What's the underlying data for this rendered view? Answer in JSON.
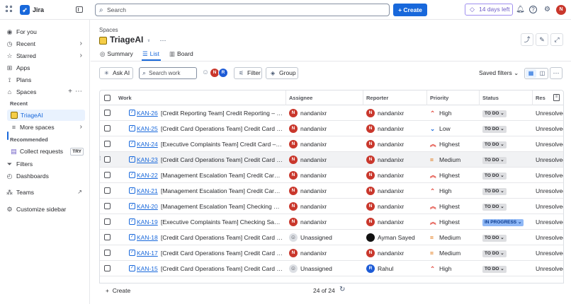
{
  "app": {
    "name": "Jira",
    "brand_color": "#1868db"
  },
  "topbar": {
    "search_placeholder": "Search",
    "create_label": "Create",
    "trial_label": "14 days left",
    "user_initial": "N"
  },
  "sidebar": {
    "items": [
      {
        "label": "For you",
        "icon": "user-circle-icon"
      },
      {
        "label": "Recent",
        "icon": "clock-icon"
      },
      {
        "label": "Starred",
        "icon": "star-icon"
      },
      {
        "label": "Apps",
        "icon": "apps-icon"
      },
      {
        "label": "Plans",
        "icon": "plans-icon"
      },
      {
        "label": "Spaces",
        "icon": "spaces-icon"
      }
    ],
    "recent_heading": "Recent",
    "active_space": "TriageAI",
    "more_spaces": "More spaces",
    "recommended_heading": "Recommended",
    "collect_requests": "Collect requests",
    "try_badge": "TRY",
    "filters": "Filters",
    "dashboards": "Dashboards",
    "teams": "Teams",
    "customize": "Customize sidebar"
  },
  "header": {
    "breadcrumb": "Spaces",
    "title": "TriageAI"
  },
  "tabs": [
    {
      "label": "Summary",
      "icon": "globe-icon"
    },
    {
      "label": "List",
      "icon": "list-icon"
    },
    {
      "label": "Board",
      "icon": "board-icon"
    }
  ],
  "toolbar": {
    "ask_ai": "Ask AI",
    "search_placeholder": "Search work",
    "filter": "Filter",
    "group": "Group",
    "saved_filters": "Saved filters",
    "avatars": [
      "N",
      "R"
    ]
  },
  "table": {
    "headers": [
      "Work",
      "Assignee",
      "Reporter",
      "Priority",
      "Status",
      "Res"
    ],
    "rows": [
      {
        "key": "KAN-26",
        "summary": "[Credit Reporting Team] Credit Reporting – In...",
        "assignee": "nandanixr",
        "reporter": "nandanixr",
        "priority": "High",
        "status": "TO DO",
        "resolution": "Unresolved"
      },
      {
        "key": "KAN-25",
        "summary": "[Credit Card Operations Team] Credit Card – F...",
        "assignee": "nandanixr",
        "reporter": "nandanixr",
        "priority": "Low",
        "status": "TO DO",
        "resolution": "Unresolved"
      },
      {
        "key": "KAN-24",
        "summary": "[Executive Complaints Team] Credit Card – F...",
        "assignee": "nandanixr",
        "reporter": "nandanixr",
        "priority": "Highest",
        "status": "TO DO",
        "resolution": "Unresolved"
      },
      {
        "key": "KAN-23",
        "summary": "[Credit Card Operations Team] Credit Card – ...",
        "assignee": "nandanixr",
        "reporter": "nandanixr",
        "priority": "Medium",
        "status": "TO DO",
        "resolution": "Unresolved"
      },
      {
        "key": "KAN-22",
        "summary": "[Management Escalation Team] Credit Card –...",
        "assignee": "nandanixr",
        "reporter": "nandanixr",
        "priority": "Highest",
        "status": "TO DO",
        "resolution": "Unresolved"
      },
      {
        "key": "KAN-21",
        "summary": "[Management Escalation Team] Credit Card –...",
        "assignee": "nandanixr",
        "reporter": "nandanixr",
        "priority": "High",
        "status": "TO DO",
        "resolution": "Unresolved"
      },
      {
        "key": "KAN-20",
        "summary": "[Management Escalation Team] Checking Sa...",
        "assignee": "nandanixr",
        "reporter": "nandanixr",
        "priority": "Highest",
        "status": "TO DO",
        "resolution": "Unresolved"
      },
      {
        "key": "KAN-19",
        "summary": "[Executive Complaints Team] Checking Savin...",
        "assignee": "nandanixr",
        "reporter": "nandanixr",
        "priority": "Highest",
        "status": "IN PROGRESS",
        "resolution": "Unresolved"
      },
      {
        "key": "KAN-18",
        "summary": "[Credit Card Operations Team] Credit Card – ...",
        "assignee": "Unassigned",
        "reporter": "Ayman Sayed",
        "priority": "Medium",
        "status": "TO DO",
        "resolution": "Unresolved"
      },
      {
        "key": "KAN-17",
        "summary": "[Credit Card Operations Team] Credit Card – ...",
        "assignee": "nandanixr",
        "reporter": "nandanixr",
        "priority": "Medium",
        "status": "TO DO",
        "resolution": "Unresolved"
      },
      {
        "key": "KAN-15",
        "summary": "[Credit Card Operations Team] Credit Card – ...",
        "assignee": "Unassigned",
        "reporter": "Rahul",
        "priority": "High",
        "status": "TO DO",
        "resolution": "Unresolved"
      }
    ]
  },
  "footer": {
    "create": "Create",
    "count": "24 of 24"
  },
  "colors": {
    "avatar_nandanixr": "#c9372c",
    "avatar_rahul": "#1d5bd6",
    "priority_high": "#e2483d",
    "priority_low": "#1868db",
    "priority_medium": "#e06c00",
    "status_todo_bg": "#dddee1",
    "status_inprogress_bg": "#8fb8f6"
  }
}
